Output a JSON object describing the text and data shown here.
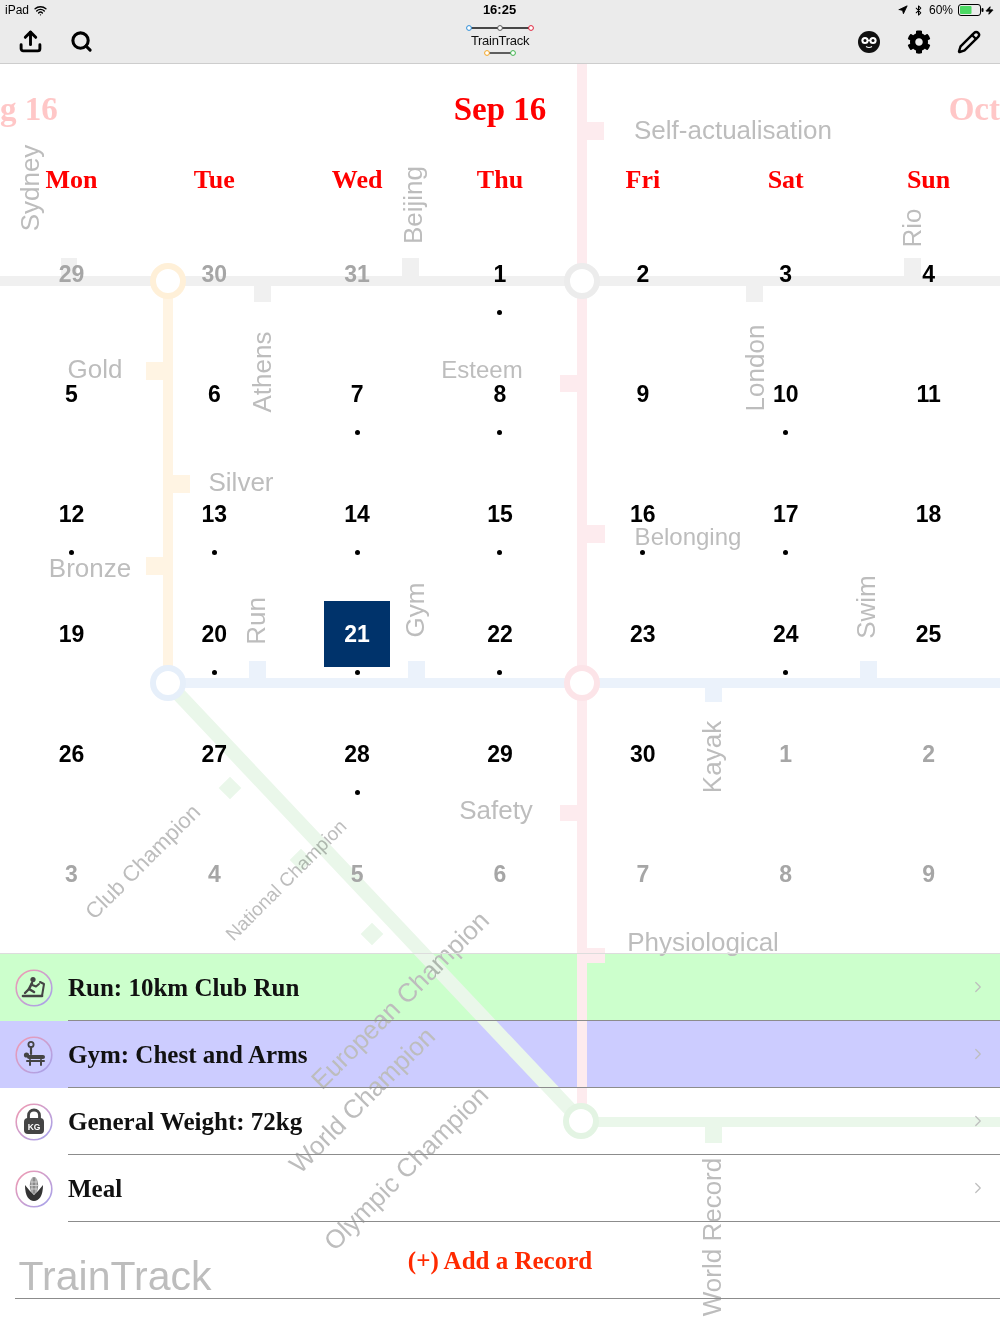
{
  "status_bar": {
    "device": "iPad",
    "time": "16:25",
    "battery": "60%"
  },
  "toolbar": {
    "logo_text": "TrainTrack"
  },
  "calendar": {
    "prev_month": "g 16",
    "month": "Sep 16",
    "next_month": "Oct",
    "weekdays": [
      "Mon",
      "Tue",
      "Wed",
      "Thu",
      "Fri",
      "Sat",
      "Sun"
    ],
    "weeks": [
      {
        "days": [
          {
            "day": "29",
            "in_month": false,
            "has_record": false,
            "selected": false
          },
          {
            "day": "30",
            "in_month": false,
            "has_record": false,
            "selected": false
          },
          {
            "day": "31",
            "in_month": false,
            "has_record": false,
            "selected": false
          },
          {
            "day": "1",
            "in_month": true,
            "has_record": true,
            "selected": false
          },
          {
            "day": "2",
            "in_month": true,
            "has_record": false,
            "selected": false
          },
          {
            "day": "3",
            "in_month": true,
            "has_record": false,
            "selected": false
          },
          {
            "day": "4",
            "in_month": true,
            "has_record": false,
            "selected": false
          }
        ]
      },
      {
        "days": [
          {
            "day": "5",
            "in_month": true,
            "has_record": false,
            "selected": false
          },
          {
            "day": "6",
            "in_month": true,
            "has_record": false,
            "selected": false
          },
          {
            "day": "7",
            "in_month": true,
            "has_record": true,
            "selected": false
          },
          {
            "day": "8",
            "in_month": true,
            "has_record": true,
            "selected": false
          },
          {
            "day": "9",
            "in_month": true,
            "has_record": false,
            "selected": false
          },
          {
            "day": "10",
            "in_month": true,
            "has_record": true,
            "selected": false
          },
          {
            "day": "11",
            "in_month": true,
            "has_record": false,
            "selected": false
          }
        ]
      },
      {
        "days": [
          {
            "day": "12",
            "in_month": true,
            "has_record": true,
            "selected": false
          },
          {
            "day": "13",
            "in_month": true,
            "has_record": true,
            "selected": false
          },
          {
            "day": "14",
            "in_month": true,
            "has_record": true,
            "selected": false
          },
          {
            "day": "15",
            "in_month": true,
            "has_record": true,
            "selected": false
          },
          {
            "day": "16",
            "in_month": true,
            "has_record": true,
            "selected": false
          },
          {
            "day": "17",
            "in_month": true,
            "has_record": true,
            "selected": false
          },
          {
            "day": "18",
            "in_month": true,
            "has_record": false,
            "selected": false
          }
        ]
      },
      {
        "days": [
          {
            "day": "19",
            "in_month": true,
            "has_record": false,
            "selected": false
          },
          {
            "day": "20",
            "in_month": true,
            "has_record": true,
            "selected": false
          },
          {
            "day": "21",
            "in_month": true,
            "has_record": true,
            "selected": true
          },
          {
            "day": "22",
            "in_month": true,
            "has_record": true,
            "selected": false
          },
          {
            "day": "23",
            "in_month": true,
            "has_record": false,
            "selected": false
          },
          {
            "day": "24",
            "in_month": true,
            "has_record": true,
            "selected": false
          },
          {
            "day": "25",
            "in_month": true,
            "has_record": false,
            "selected": false
          }
        ]
      },
      {
        "days": [
          {
            "day": "26",
            "in_month": true,
            "has_record": false,
            "selected": false
          },
          {
            "day": "27",
            "in_month": true,
            "has_record": false,
            "selected": false
          },
          {
            "day": "28",
            "in_month": true,
            "has_record": true,
            "selected": false
          },
          {
            "day": "29",
            "in_month": true,
            "has_record": false,
            "selected": false
          },
          {
            "day": "30",
            "in_month": true,
            "has_record": false,
            "selected": false
          },
          {
            "day": "1",
            "in_month": false,
            "has_record": false,
            "selected": false
          },
          {
            "day": "2",
            "in_month": false,
            "has_record": false,
            "selected": false
          }
        ]
      },
      {
        "days": [
          {
            "day": "3",
            "in_month": false,
            "has_record": false,
            "selected": false
          },
          {
            "day": "4",
            "in_month": false,
            "has_record": false,
            "selected": false
          },
          {
            "day": "5",
            "in_month": false,
            "has_record": false,
            "selected": false
          },
          {
            "day": "6",
            "in_month": false,
            "has_record": false,
            "selected": false
          },
          {
            "day": "7",
            "in_month": false,
            "has_record": false,
            "selected": false
          },
          {
            "day": "8",
            "in_month": false,
            "has_record": false,
            "selected": false
          },
          {
            "day": "9",
            "in_month": false,
            "has_record": false,
            "selected": false
          }
        ]
      }
    ]
  },
  "records": [
    {
      "kind": "run",
      "title": "Run: 10km Club Run",
      "color": "#ccffcc"
    },
    {
      "kind": "gym",
      "title": "Gym: Chest and Arms",
      "color": "#ccccff"
    },
    {
      "kind": "weight",
      "title": "General Weight: 72kg",
      "icon_text": "KG"
    },
    {
      "kind": "meal",
      "title": "Meal"
    }
  ],
  "add_record": "(+) Add a Record",
  "background_map": {
    "labels": [
      "Self-actualisation",
      "Sydney",
      "Beijing",
      "Rio",
      "Gold",
      "Athens",
      "Esteem",
      "London",
      "Silver",
      "Belonging",
      "Bronze",
      "Run",
      "Gym",
      "Swim",
      "Kayak",
      "Safety",
      "Club Champion",
      "National Champion",
      "European Champion",
      "World Champion",
      "Olympic Champion",
      "Physiological",
      "World Record",
      "TrainTrack"
    ]
  }
}
